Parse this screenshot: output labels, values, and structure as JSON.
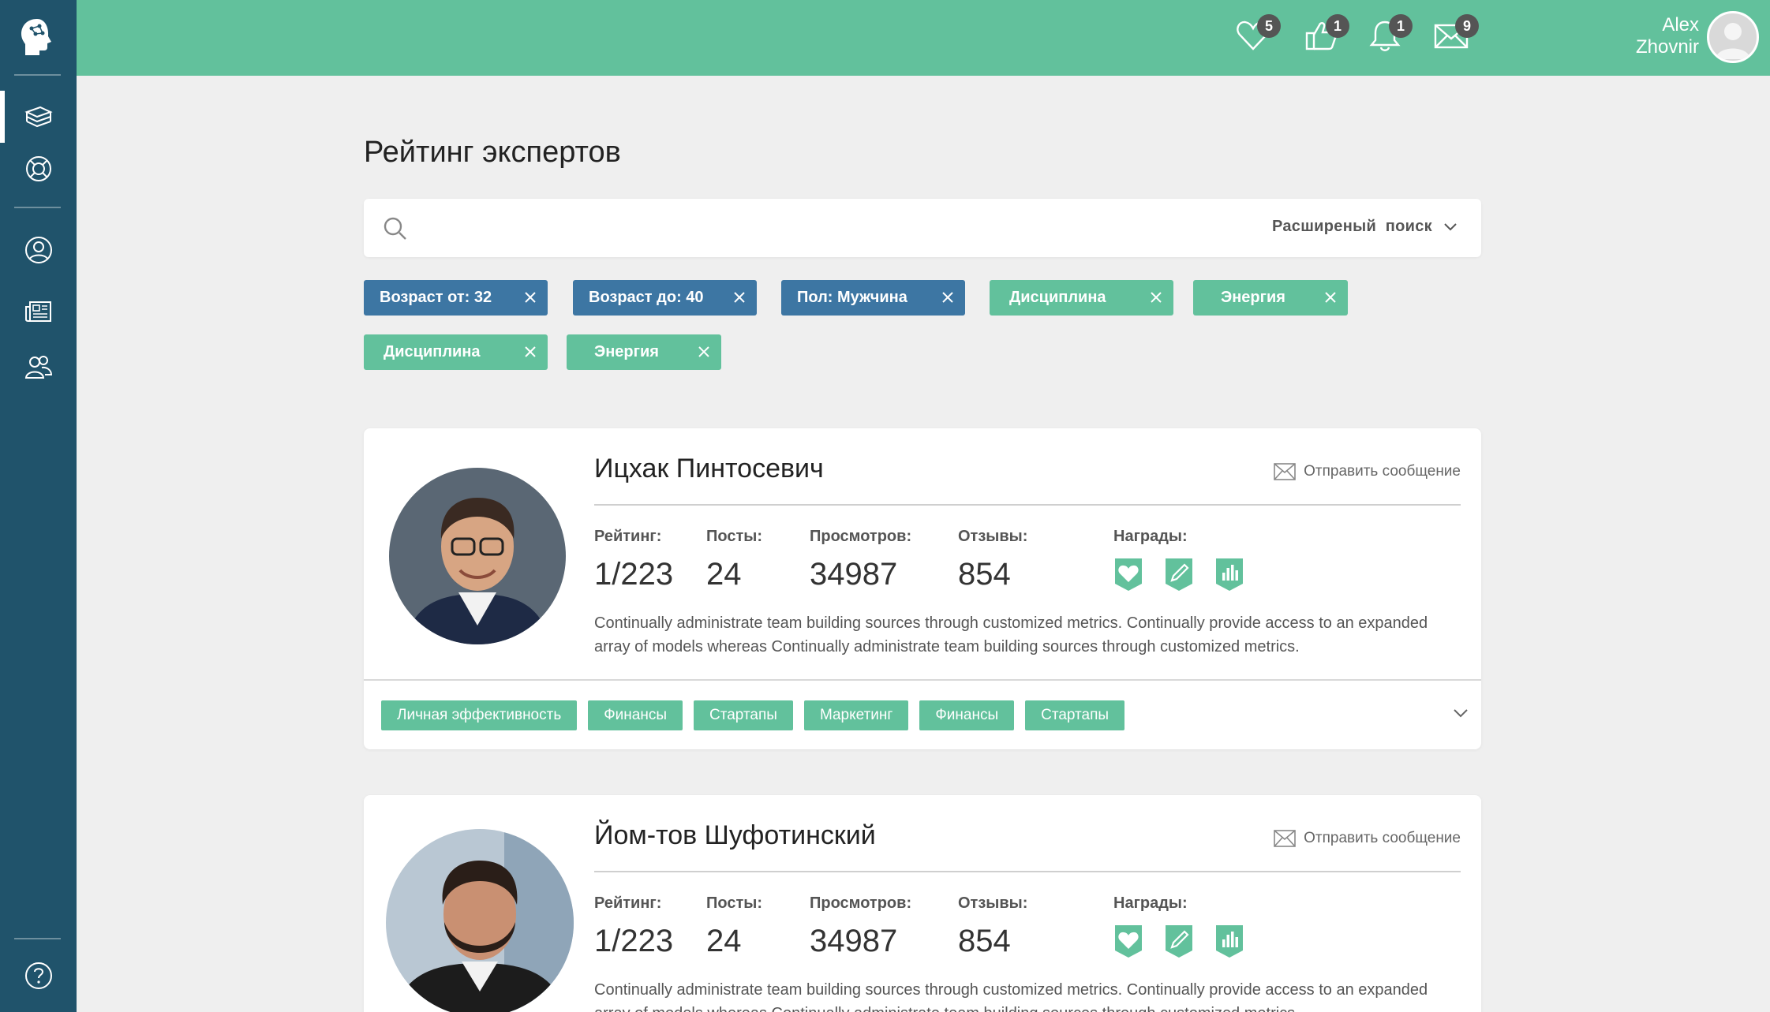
{
  "header": {
    "badges": {
      "likes": "5",
      "thumbs": "1",
      "bell": "1",
      "messages": "9"
    },
    "user_name_line1": "Alex",
    "user_name_line2": "Zhovnir"
  },
  "sidebar": {
    "items": [
      "book-stack-icon",
      "lifebuoy-icon",
      "profile-icon",
      "newspaper-icon",
      "group-icon"
    ],
    "help_icon": "question-icon"
  },
  "page": {
    "title": "Рейтинг экспертов",
    "search_placeholder": "",
    "advanced_search": "Расширеный  поиск"
  },
  "filters": [
    {
      "label": "Возраст от: 32",
      "color": "#3d76a3"
    },
    {
      "label": "Возраст до: 40",
      "color": "#3d76a3"
    },
    {
      "label": "Пол: Мужчина",
      "color": "#3d76a3"
    },
    {
      "label": "Дисциплина",
      "color": "#62c19c"
    },
    {
      "label": "Энергия",
      "color": "#62c19c"
    },
    {
      "label": "Дисциплина",
      "color": "#62c19c"
    },
    {
      "label": "Энергия",
      "color": "#62c19c"
    }
  ],
  "labels": {
    "send_message": "Отправить сообщение",
    "rating": "Рейтинг:",
    "posts": "Посты:",
    "views": "Просмотров:",
    "reviews": "Отзывы:",
    "awards": "Награды:"
  },
  "experts": [
    {
      "name": "Ицхак Пинтосевич",
      "rating": "1/223",
      "posts": "24",
      "views": "34987",
      "reviews": "854",
      "description": "Continually administrate team building sources through customized metrics. Continually provide access to an expanded array of models whereas Continually administrate team building sources through customized metrics.",
      "tags": [
        "Личная эффективность",
        "Финансы",
        "Стартапы",
        "Маркетинг",
        "Финансы",
        "Стартапы"
      ]
    },
    {
      "name": "Йом-тов Шуфотинский",
      "rating": "1/223",
      "posts": "24",
      "views": "34987",
      "reviews": "854",
      "description": "Continually administrate team building sources through customized metrics. Continually provide access to an expanded array of models whereas Continually administrate team building sources through customized metrics.",
      "tags": []
    }
  ],
  "colors": {
    "accent": "#62c19c",
    "sidebar": "#20536b",
    "chip_blue": "#3d76a3"
  }
}
